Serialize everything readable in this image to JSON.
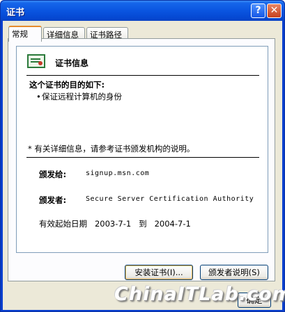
{
  "window": {
    "title": "证书",
    "help_glyph": "?",
    "close_glyph": "✕"
  },
  "tabs": [
    "常规",
    "详细信息",
    "证书路径"
  ],
  "cert": {
    "header": "证书信息",
    "purpose_heading": "这个证书的目的如下:",
    "purposes": [
      "保证远程计算机的身份"
    ],
    "note": "* 有关详细信息，请参考证书颁发机构的说明。",
    "issued_to_label": "颁发给:",
    "issued_to": "signup.msn.com",
    "issued_by_label": "颁发者:",
    "issued_by": "Secure Server Certification Authority",
    "validity": "有效起始日期   2003-7-1   到   2004-7-1"
  },
  "buttons": {
    "install": "安装证书(I)...",
    "issuer_statement": "颁发者说明(S)",
    "ok": "确定"
  },
  "watermark": "ChinaITLab.com",
  "colors": {
    "title_bar": "#0a55e0",
    "dialog_face": "#ece9d8",
    "active_tab_accent": "#e68b2c"
  }
}
